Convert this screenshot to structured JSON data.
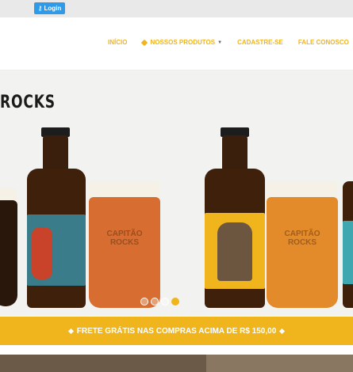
{
  "topbar": {
    "login_label": "Login",
    "login_icon": "key-icon"
  },
  "nav": {
    "items": [
      {
        "label": "INÍCIO"
      },
      {
        "label": "NOSSOS PRODUTOS",
        "icon": "tag-icon",
        "has_dropdown": true
      },
      {
        "label": "CADASTRE-SE"
      },
      {
        "label": "FALE CONOSCO"
      }
    ]
  },
  "hero": {
    "brand_text": "ROCKS",
    "slides_count": 4,
    "active_slide": 4
  },
  "promo": {
    "text": "FRETE GRÁTIS NAS COMPRAS ACIMA DE R$ 150,00"
  },
  "colors": {
    "accent": "#f0b51c",
    "login": "#2f9be8",
    "topbar": "#e9e9e9"
  }
}
